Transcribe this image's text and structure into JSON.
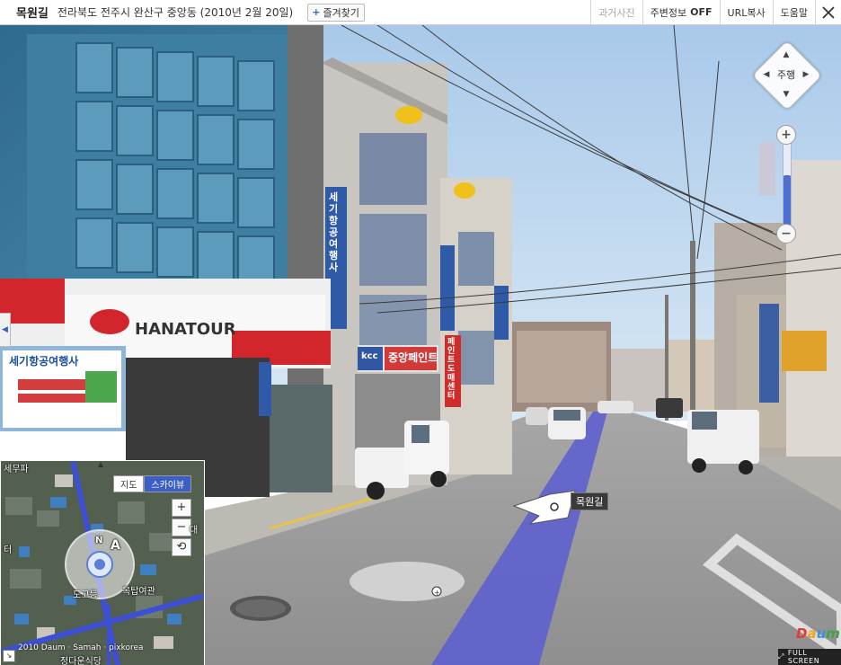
{
  "header": {
    "place": "목원길",
    "address": "전라북도 전주시 완산구 중앙동 (2010년 2월 20일)",
    "favorite_label": "즐겨찾기",
    "favorite_icon": "plus-icon",
    "past_photos": "과거사진",
    "nearby_label": "주변정보",
    "nearby_state": "OFF",
    "url_copy": "URL복사",
    "help": "도움말",
    "close_icon": "close-icon"
  },
  "navigation": {
    "center_label": "주행",
    "up_icon": "chevron-up-icon",
    "down_icon": "chevron-down-icon",
    "left_icon": "chevron-left-icon",
    "right_icon": "chevron-right-icon",
    "zoom_in": "+",
    "zoom_out": "−",
    "zoom_level": 0.6
  },
  "street_label": "목원길",
  "signs": {
    "hanatour": "HANATOUR",
    "travel_sign": "세기항공여행사",
    "store_sign": "중앙페인트",
    "store_sign_prefix": "kcc",
    "paint_vertical": "페인트도매센터",
    "vertical_travel": "세기항공여행사"
  },
  "minimap": {
    "tab_map": "지도",
    "tab_sky": "스카이뷰",
    "zoom_in": "+",
    "zoom_out": "−",
    "rotate_icon": "rotate-icon",
    "compass_letter": "A",
    "north_letter": "N",
    "copyright": "2010 Daum · Samah · pixkorea",
    "labels": {
      "top_left": "세무파",
      "left": "터",
      "school": "도고등",
      "inn": "목탑여관",
      "bottom": "정다운식당",
      "right": "대"
    }
  },
  "footer": {
    "fullscreen": "FULL SCREEN",
    "brand": "Daum"
  },
  "colors": {
    "accent": "#3b5fc7",
    "road_line": "#5c5fd0",
    "sky": "#b6d4ee"
  }
}
